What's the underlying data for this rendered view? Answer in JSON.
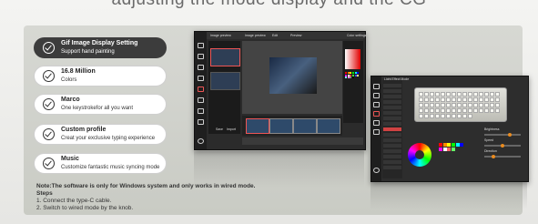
{
  "headline": "adjusting the mode display and the CG",
  "features": [
    {
      "title": "Gif Image Display Setting",
      "subtitle": "Support hand painting",
      "active": true,
      "icon": "check-circle-icon"
    },
    {
      "title": "16.8 Million",
      "subtitle": "Colors",
      "active": false,
      "icon": "check-circle-icon"
    },
    {
      "title": "Marco",
      "subtitle": "One keystrokefor all you want",
      "active": false,
      "icon": "check-circle-icon"
    },
    {
      "title": "Custom profile",
      "subtitle": "Creat your exclusive typing experience",
      "active": false,
      "icon": "check-circle-icon"
    },
    {
      "title": "Music",
      "subtitle": "Customize fantastic music syncing mode",
      "active": false,
      "icon": "check-circle-icon"
    }
  ],
  "notes": {
    "note": "Note:The software is only for Windows system and only works in wired mode.",
    "steps_title": "Steps",
    "step1": "1. Connect the type-C cable.",
    "step2": "2. Switch to wired mode by the knob."
  },
  "app1": {
    "tabs": [
      "Image preview",
      "Edit",
      "Preview"
    ],
    "panel_title": "Color settings",
    "left_header": "Image preview",
    "bottom_buttons": [
      "Save",
      "Import"
    ]
  },
  "app2": {
    "title": "Light Effect Mode",
    "labels": [
      "Brightness",
      "Speed",
      "Direction"
    ]
  },
  "colors": {
    "accent_red": "#d04242",
    "accent_orange": "#e98b1f",
    "pill_dark": "#3c3c3c",
    "panel_bg": "#d2d3cd"
  }
}
